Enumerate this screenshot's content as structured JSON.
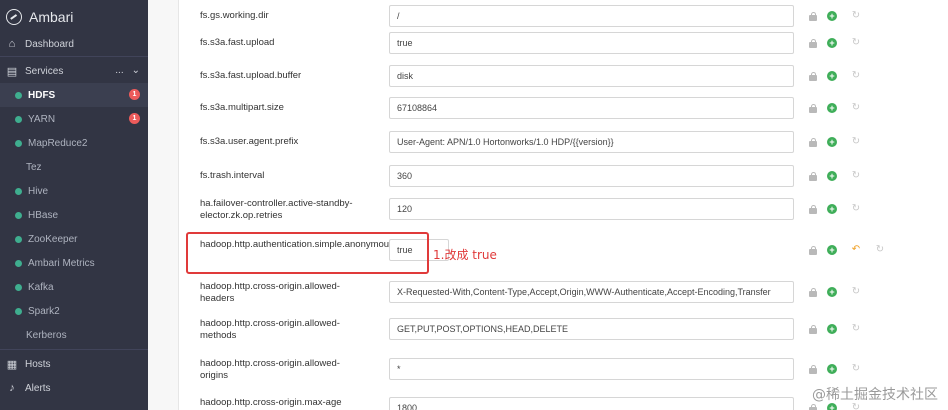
{
  "app": {
    "title": "Ambari"
  },
  "sidebar": {
    "dashboard": "Dashboard",
    "services": "Services",
    "services_menu": "...",
    "services_chevron": "⌄",
    "items": [
      {
        "label": "HDFS",
        "badge": "1",
        "status": true
      },
      {
        "label": "YARN",
        "badge": "1",
        "status": true
      },
      {
        "label": "MapReduce2",
        "badge": "",
        "status": true
      },
      {
        "label": "Tez",
        "badge": "",
        "status": false
      },
      {
        "label": "Hive",
        "badge": "",
        "status": true
      },
      {
        "label": "HBase",
        "badge": "",
        "status": true
      },
      {
        "label": "ZooKeeper",
        "badge": "",
        "status": true
      },
      {
        "label": "Ambari Metrics",
        "badge": "",
        "status": true
      },
      {
        "label": "Kafka",
        "badge": "",
        "status": true
      },
      {
        "label": "Spark2",
        "badge": "",
        "status": true
      },
      {
        "label": "Kerberos",
        "badge": "",
        "status": false
      }
    ],
    "hosts": "Hosts",
    "alerts": "Alerts"
  },
  "config": {
    "rows": [
      {
        "name": "fs.gs.working.dir",
        "value": "/"
      },
      {
        "name": "fs.s3a.fast.upload",
        "value": "true"
      },
      {
        "name": "fs.s3a.fast.upload.buffer",
        "value": "disk"
      },
      {
        "name": "fs.s3a.multipart.size",
        "value": "67108864"
      },
      {
        "name": "fs.s3a.user.agent.prefix",
        "value": "User-Agent: APN/1.0 Hortonworks/1.0 HDP/{{version}}"
      },
      {
        "name": "fs.trash.interval",
        "value": "360"
      },
      {
        "name": "ha.failover-controller.active-standby-elector.zk.op.retries",
        "value": "120"
      },
      {
        "name": "hadoop.http.authentication.simple.anonymous.allowed",
        "value": "true"
      },
      {
        "name": "hadoop.http.cross-origin.allowed-headers",
        "value": "X-Requested-With,Content-Type,Accept,Origin,WWW-Authenticate,Accept-Encoding,Transfer"
      },
      {
        "name": "hadoop.http.cross-origin.allowed-methods",
        "value": "GET,PUT,POST,OPTIONS,HEAD,DELETE"
      },
      {
        "name": "hadoop.http.cross-origin.allowed-origins",
        "value": "*"
      },
      {
        "name": "hadoop.http.cross-origin.max-age",
        "value": "1800"
      }
    ]
  },
  "annotation": {
    "text": "1.改成 true"
  },
  "watermark": {
    "text": "@稀土掘金技术社区"
  },
  "colors": {
    "sidebar_bg": "#323544",
    "status_green": "#3fae8f",
    "badge_red": "#ec5b5b",
    "annotation_red": "#e03a3a",
    "add_green": "#3fae59",
    "undo_orange": "#f0a024"
  }
}
